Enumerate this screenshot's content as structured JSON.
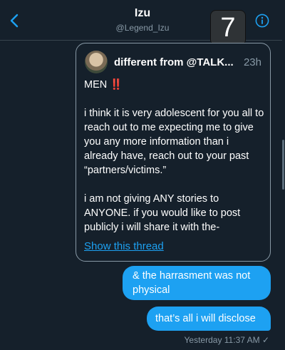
{
  "header": {
    "name": "Izu",
    "handle": "@Legend_Izu",
    "badge_number": "7"
  },
  "quoted_tweet": {
    "author": "different from @TALK...",
    "time": "23h",
    "line1_text": "MEN",
    "line1_emoji": "‼️",
    "paragraph2": "i think it is very adolescent for you all to reach out to me expecting me to give you any more information than i already have, reach out to your past “partners/victims.”",
    "paragraph3": "i am not giving ANY stories to ANYONE. if you would like to post publicly i will share it with the-",
    "show_thread": "Show this thread"
  },
  "messages": [
    {
      "text": "& the harrasment was not physical"
    },
    {
      "text": "that’s all i will disclose"
    }
  ],
  "timestamp": "Yesterday 11:37 AM",
  "read_mark": "✓",
  "colors": {
    "background": "#15202b",
    "accent": "#1da1f2",
    "muted": "#8899a6"
  },
  "icons": {
    "back": "chevron-left-icon",
    "info": "info-circle-icon"
  }
}
